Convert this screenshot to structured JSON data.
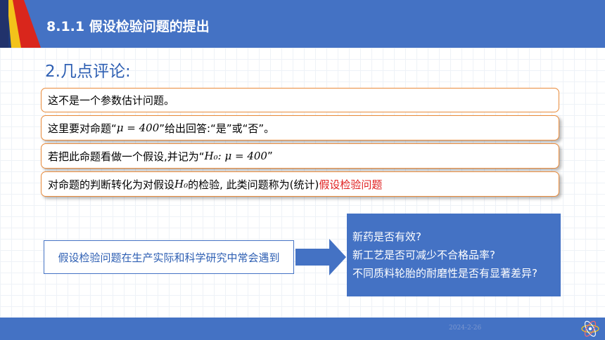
{
  "header": {
    "title": "8.1.1 假设检验问题的提出"
  },
  "subtitle": "2.几点评论:",
  "points": [
    {
      "text": "这不是一个参数估计问题。"
    },
    {
      "pre": "这里要对命题“",
      "math": "μ = 400",
      "post": "”给出回答:“是”或“否”。"
    },
    {
      "pre": "若把此命题看做一个假设,并记为“",
      "math": "H₀: μ = 400",
      "post": "”"
    },
    {
      "pre": "对命题的判断转化为对假设",
      "math": "H₀",
      "mid": "的检验, 此类问题称为(统计)",
      "highlight": "假设检验问题"
    }
  ],
  "flow": {
    "source": "假设检验问题在生产实际和科学研究中常会遇到",
    "examples": [
      "新药是否有效?",
      "新工艺是否可减少不合格品率?",
      "不同质料轮胎的耐磨性是否有显著差异?"
    ]
  },
  "footer": {
    "date": "2024-2-26"
  },
  "colors": {
    "bar": "#4472c4",
    "item_border": "#e88a3a",
    "highlight": "#e02020",
    "subtitle": "#2e5fb3"
  }
}
